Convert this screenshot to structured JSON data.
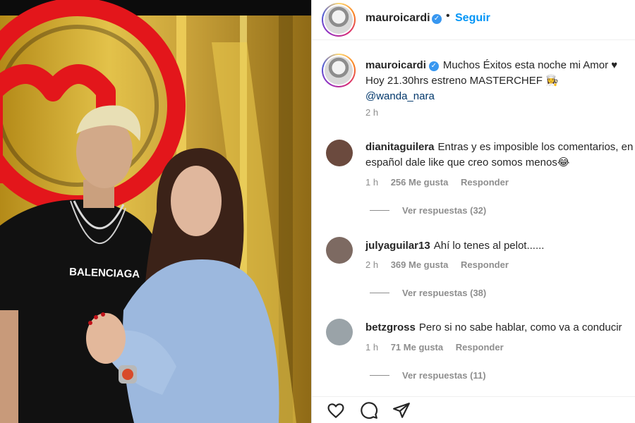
{
  "post": {
    "image_alt": "Photo of a couple in front of a gold and red MasterChef logo",
    "shirt_text": "BALENCIAGA"
  },
  "header": {
    "username": "mauroicardi",
    "verified_mark": "✓",
    "separator": "•",
    "follow_label": "Seguir"
  },
  "caption": {
    "username": "mauroicardi",
    "verified_mark": "✓",
    "line1": "Muchos Éxitos esta noche mi Amor ♥",
    "line2": "Hoy 21.30hrs estreno MASTERCHEF 👩‍🍳",
    "mention": "@wanda_nara",
    "time": "2 h"
  },
  "comments": [
    {
      "username": "dianitaguilera",
      "text": "Entras y es imposible los comentarios, en español dale like que creo somos menos😂",
      "time": "1 h",
      "likes": "256 Me gusta",
      "reply_label": "Responder",
      "view_replies": "Ver respuestas (32)",
      "avatar_color": "#6b4a3e"
    },
    {
      "username": "julyaguilar13",
      "text": "Ahí lo tenes al pelot......",
      "time": "2 h",
      "likes": "369 Me gusta",
      "reply_label": "Responder",
      "view_replies": "Ver respuestas (38)",
      "avatar_color": "#7d6a62"
    },
    {
      "username": "betzgross",
      "text": "Pero si no sabe hablar, como va a conducir",
      "time": "1 h",
      "likes": "71 Me gusta",
      "reply_label": "Responder",
      "view_replies": "Ver respuestas (11)",
      "avatar_color": "#9aa3a8"
    }
  ],
  "actions": {
    "icons": [
      "heart-icon",
      "comment-icon",
      "share-icon"
    ]
  },
  "colors": {
    "link_blue": "#0095f6",
    "mention_blue": "#00376b",
    "muted_gray": "#8e8e8e",
    "text_dark": "#262626",
    "verified_blue": "#3897f0"
  }
}
